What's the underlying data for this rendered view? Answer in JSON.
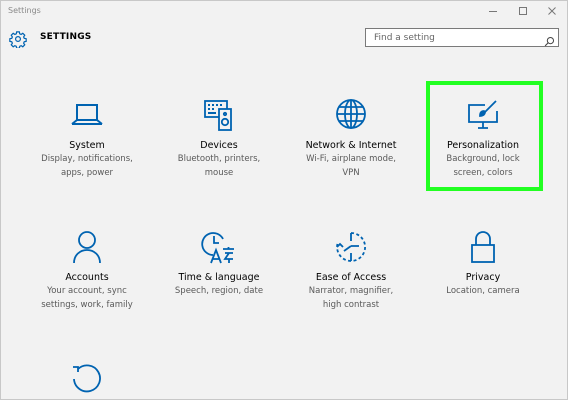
{
  "window": {
    "title": "Settings"
  },
  "header": {
    "title": "SETTINGS",
    "icon": "gear-icon"
  },
  "search": {
    "placeholder": "Find a setting",
    "value": "",
    "icon": "search-icon"
  },
  "tiles": [
    {
      "id": "system",
      "name": "System",
      "desc1": "Display, notifications,",
      "desc2": "apps, power",
      "icon": "laptop-icon"
    },
    {
      "id": "devices",
      "name": "Devices",
      "desc1": "Bluetooth, printers,",
      "desc2": "mouse",
      "icon": "keyboard-speaker-icon"
    },
    {
      "id": "network",
      "name": "Network & Internet",
      "desc1": "Wi-Fi, airplane mode,",
      "desc2": "VPN",
      "icon": "globe-icon"
    },
    {
      "id": "personalization",
      "name": "Personalization",
      "desc1": "Background, lock",
      "desc2": "screen, colors",
      "icon": "paint-brush-monitor-icon"
    },
    {
      "id": "accounts",
      "name": "Accounts",
      "desc1": "Your account, sync",
      "desc2": "settings, work, family",
      "icon": "person-icon"
    },
    {
      "id": "time-language",
      "name": "Time & language",
      "desc1": "Speech, region, date",
      "desc2": "",
      "icon": "time-language-icon"
    },
    {
      "id": "ease-of-access",
      "name": "Ease of Access",
      "desc1": "Narrator, magnifier,",
      "desc2": "high contrast",
      "icon": "ease-of-access-icon"
    },
    {
      "id": "privacy",
      "name": "Privacy",
      "desc1": "Location, camera",
      "desc2": "",
      "icon": "lock-icon"
    },
    {
      "id": "update-security",
      "name": "",
      "desc1": "",
      "desc2": "",
      "icon": "refresh-icon"
    }
  ],
  "colors": {
    "accent": "#0063b1",
    "highlight": "#22ff22",
    "background": "#f2f2f2"
  }
}
